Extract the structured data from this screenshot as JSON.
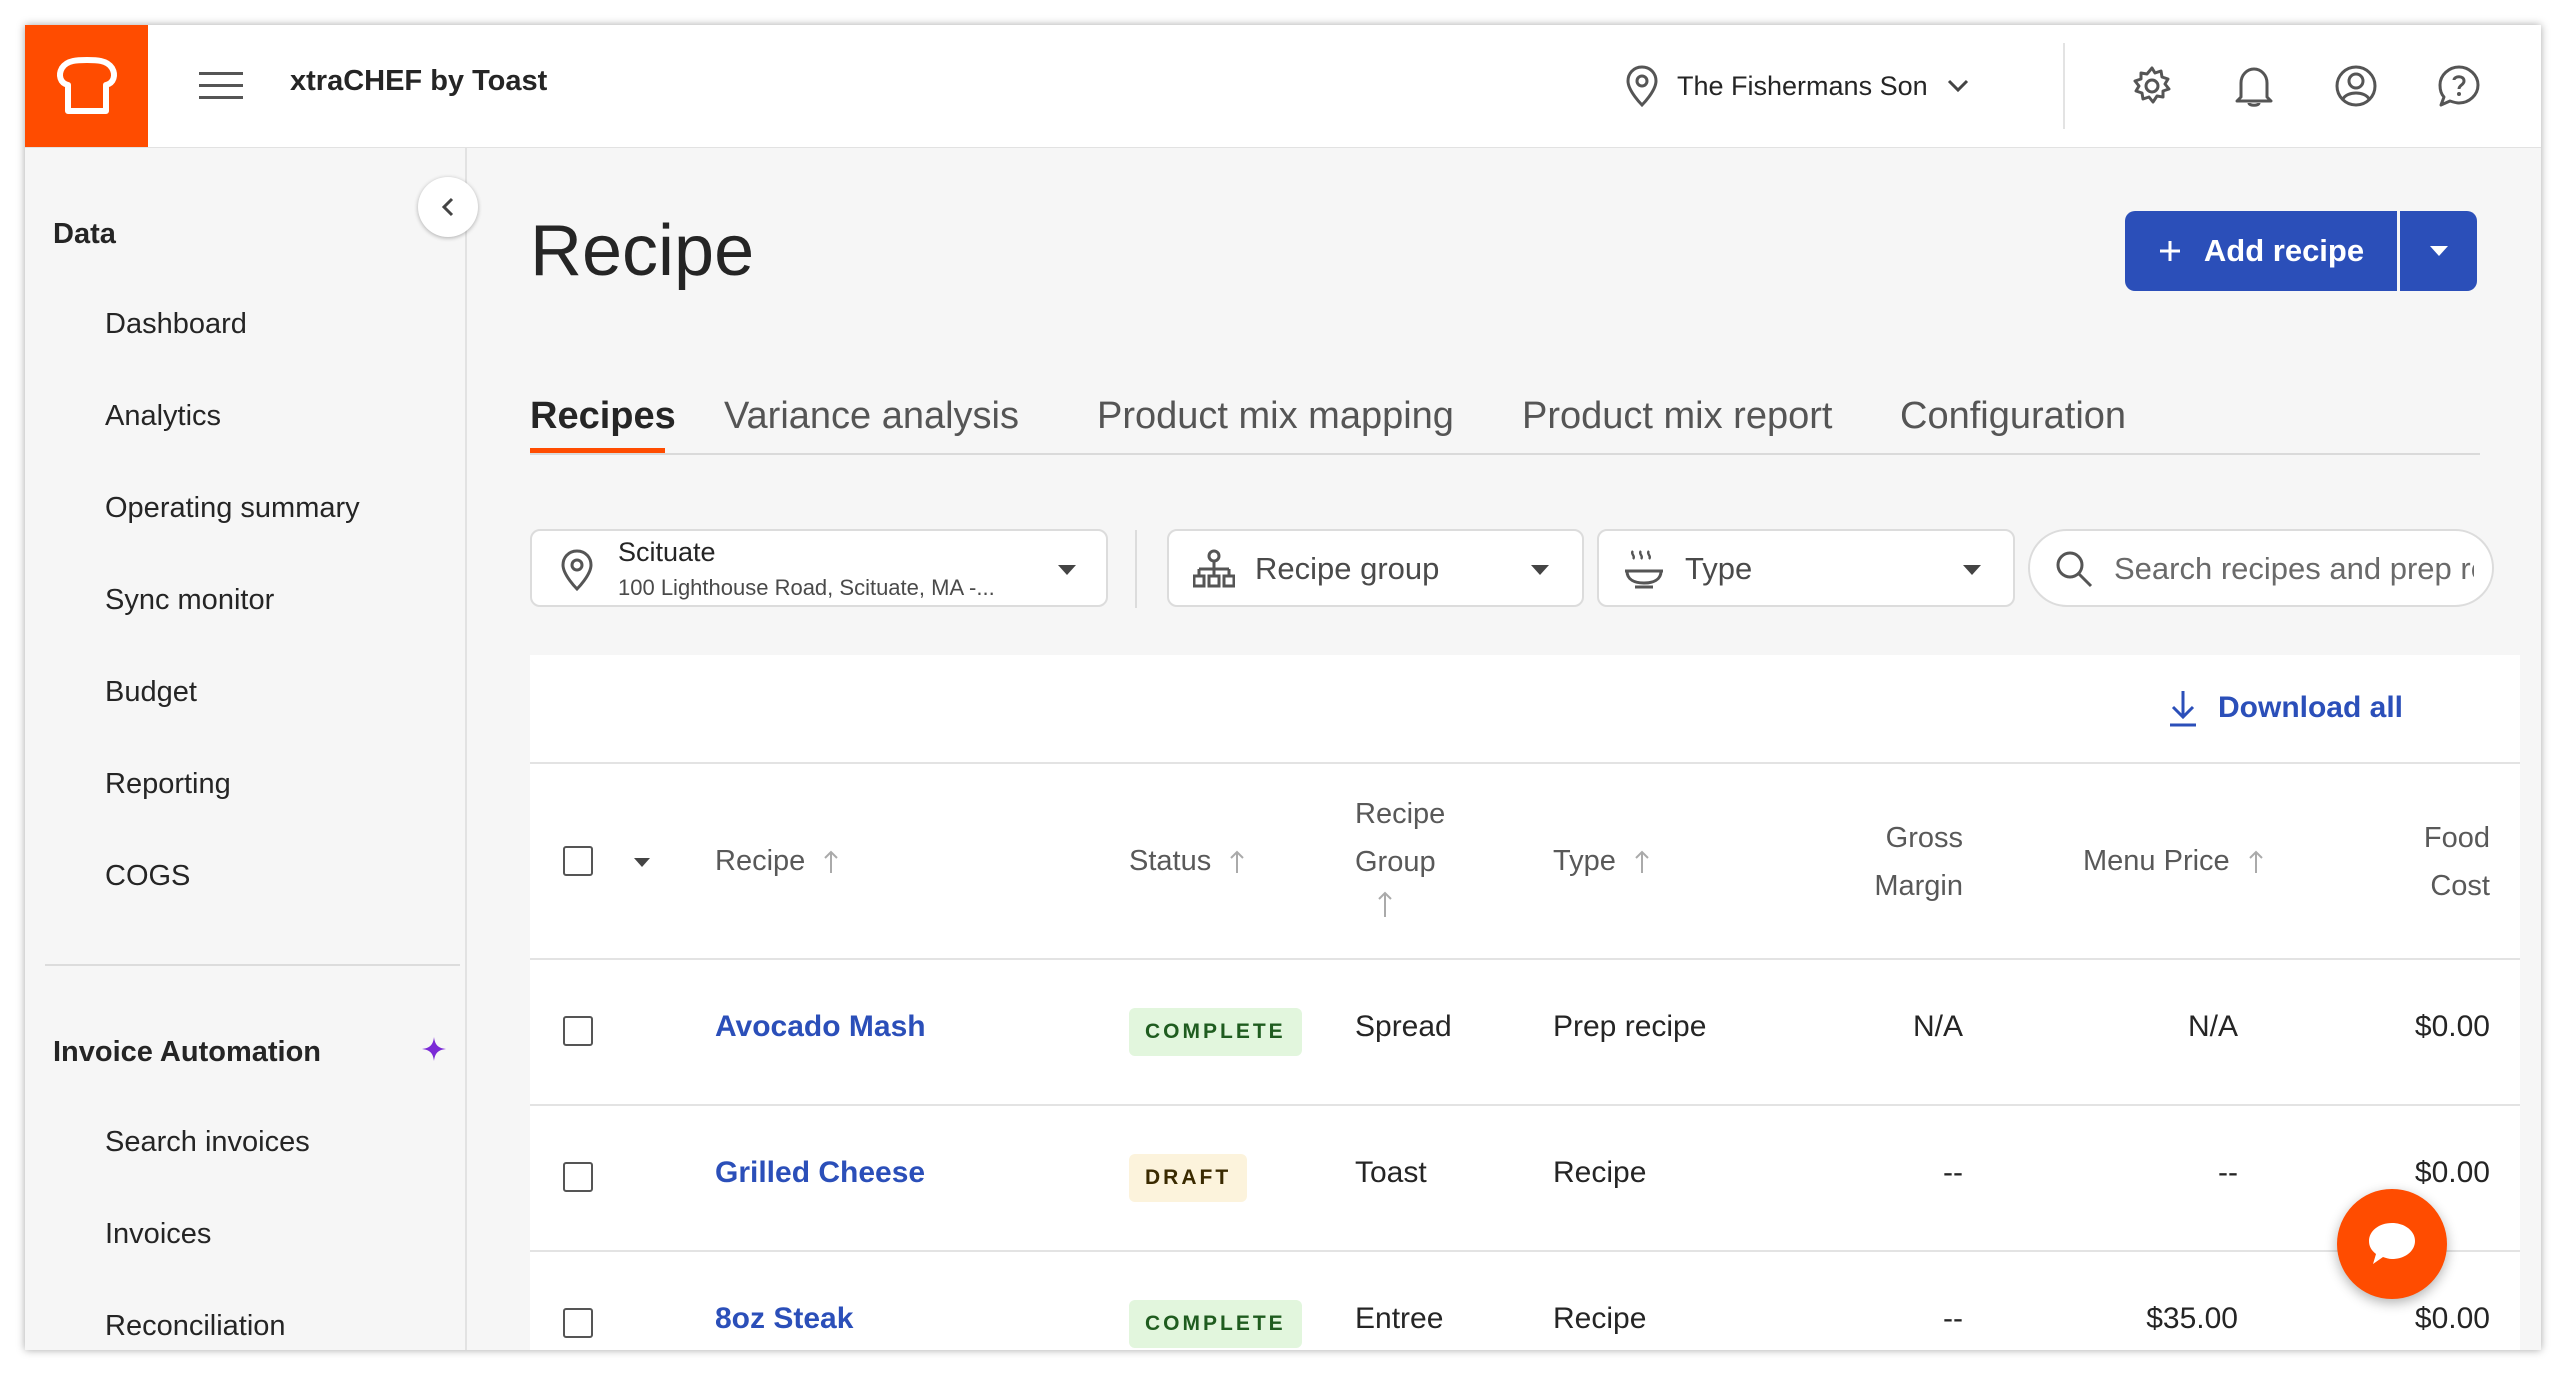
{
  "app": {
    "title": "xtraCHEF by Toast"
  },
  "header": {
    "location_name": "The Fishermans Son"
  },
  "sidebar": {
    "section_data": "Data",
    "data_items": [
      "Dashboard",
      "Analytics",
      "Operating summary",
      "Sync monitor",
      "Budget",
      "Reporting",
      "COGS"
    ],
    "section_invoice": "Invoice Automation",
    "invoice_items": [
      "Search invoices",
      "Invoices",
      "Reconciliation"
    ]
  },
  "page": {
    "title": "Recipe",
    "add_button": "Add recipe",
    "tabs": [
      "Recipes",
      "Variance analysis",
      "Product mix mapping",
      "Product mix report",
      "Configuration"
    ],
    "active_tab": "Recipes"
  },
  "filters": {
    "location_title": "Scituate",
    "location_address": "100 Lighthouse Road, Scituate, MA -...",
    "recipe_group": "Recipe group",
    "type": "Type",
    "search_placeholder": "Search recipes and prep re"
  },
  "table": {
    "download_label": "Download all",
    "headers": {
      "recipe": "Recipe",
      "status": "Status",
      "recipe_group_1": "Recipe",
      "recipe_group_2": "Group",
      "type": "Type",
      "gross_margin_1": "Gross",
      "gross_margin_2": "Margin",
      "menu_price": "Menu Price",
      "food_cost_1": "Food",
      "food_cost_2": "Cost"
    },
    "rows": [
      {
        "name": "Avocado Mash",
        "status": "COMPLETE",
        "group": "Spread",
        "type": "Prep recipe",
        "gross_margin": "N/A",
        "menu_price": "N/A",
        "food_cost": "$0.00"
      },
      {
        "name": "Grilled Cheese",
        "status": "DRAFT",
        "group": "Toast",
        "type": "Recipe",
        "gross_margin": "--",
        "menu_price": "--",
        "food_cost": "$0.00"
      },
      {
        "name": "8oz Steak",
        "status": "COMPLETE",
        "group": "Entree",
        "type": "Recipe",
        "gross_margin": "--",
        "menu_price": "$35.00",
        "food_cost": "$0.00"
      }
    ]
  },
  "colors": {
    "brand": "#ff4c00",
    "primary": "#2b4fb9",
    "complete_bg": "#e2f6dd",
    "draft_bg": "#fcf3dc"
  }
}
